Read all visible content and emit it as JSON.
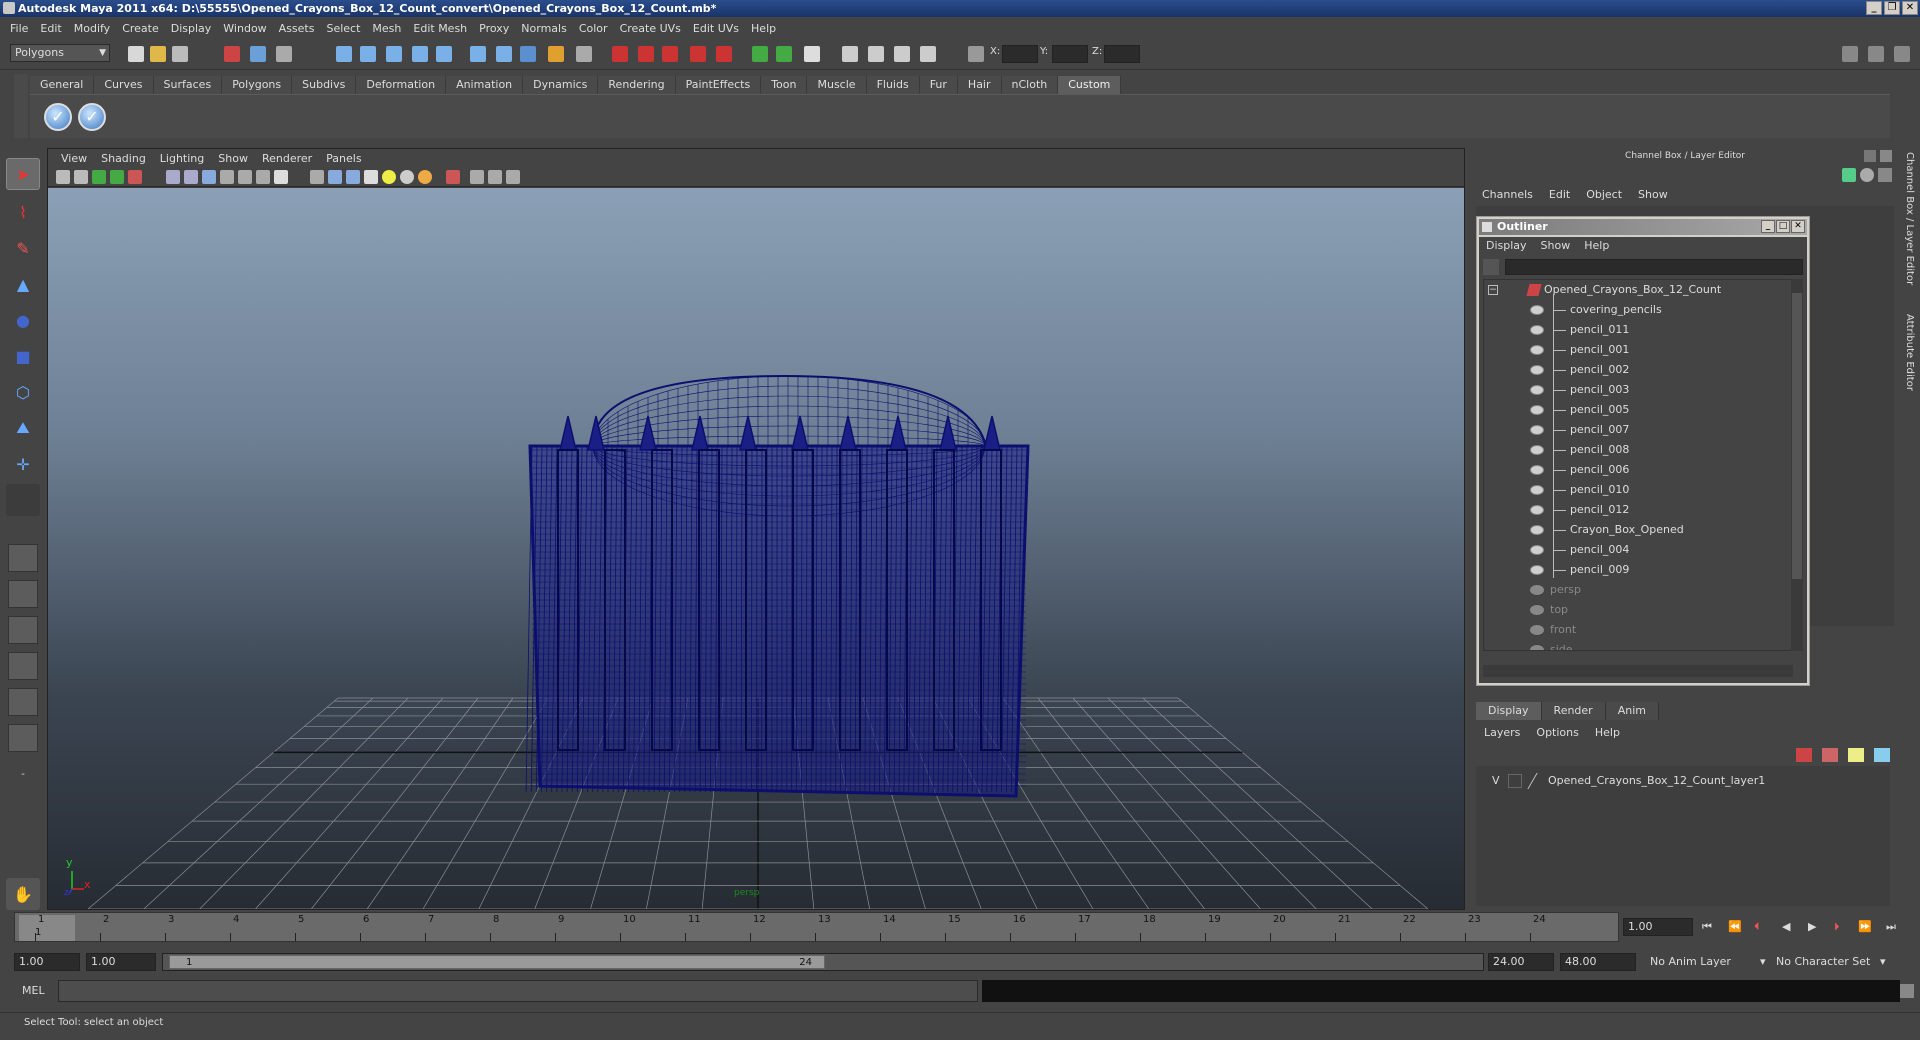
{
  "window": {
    "title": "Autodesk Maya 2011 x64: D:\\55555\\Opened_Crayons_Box_12_Count_convert\\Opened_Crayons_Box_12_Count.mb*"
  },
  "menus": [
    "File",
    "Edit",
    "Modify",
    "Create",
    "Display",
    "Window",
    "Assets",
    "Select",
    "Mesh",
    "Edit Mesh",
    "Proxy",
    "Normals",
    "Color",
    "Create UVs",
    "Edit UVs",
    "Help"
  ],
  "toolbar": {
    "mode": "Polygons",
    "x_label": "X:",
    "y_label": "Y:",
    "z_label": "Z:"
  },
  "shelf": {
    "tabs": [
      "General",
      "Curves",
      "Surfaces",
      "Polygons",
      "Subdivs",
      "Deformation",
      "Animation",
      "Dynamics",
      "Rendering",
      "PaintEffects",
      "Toon",
      "Muscle",
      "Fluids",
      "Fur",
      "Hair",
      "nCloth",
      "Custom"
    ],
    "active_tab": "Custom"
  },
  "viewport": {
    "menu": [
      "View",
      "Shading",
      "Lighting",
      "Show",
      "Renderer",
      "Panels"
    ],
    "camera_label": "persp",
    "axis_y": "y",
    "axis_x": "x",
    "axis_z": "z"
  },
  "right_panel": {
    "title": "Channel Box / Layer Editor",
    "menu": [
      "Channels",
      "Edit",
      "Object",
      "Show"
    ],
    "side_tab_1": "Channel Box / Layer Editor",
    "side_tab_2": "Attribute Editor"
  },
  "outliner": {
    "title": "Outliner",
    "menu": [
      "Display",
      "Show",
      "Help"
    ],
    "root": "Opened_Crayons_Box_12_Count",
    "children": [
      "covering_pencils",
      "pencil_011",
      "pencil_001",
      "pencil_002",
      "pencil_003",
      "pencil_005",
      "pencil_007",
      "pencil_008",
      "pencil_006",
      "pencil_010",
      "pencil_012",
      "Crayon_Box_Opened",
      "pencil_004",
      "pencil_009"
    ],
    "cameras": [
      "persp",
      "top",
      "front",
      "side"
    ]
  },
  "layer_editor": {
    "tabs": [
      "Display",
      "Render",
      "Anim"
    ],
    "active_tab": "Display",
    "menu": [
      "Layers",
      "Options",
      "Help"
    ],
    "layers": [
      {
        "visible": "V",
        "name": "Opened_Crayons_Box_12_Count_layer1"
      }
    ]
  },
  "timeline": {
    "ticks": [
      "1",
      "2",
      "3",
      "4",
      "5",
      "6",
      "7",
      "8",
      "9",
      "10",
      "11",
      "12",
      "13",
      "14",
      "15",
      "16",
      "17",
      "18",
      "19",
      "20",
      "21",
      "22",
      "23",
      "24"
    ],
    "current_marker": "1",
    "current_frame": "1.00"
  },
  "range": {
    "start": "1.00",
    "playback_start": "1.00",
    "handle_start": "1",
    "handle_end": "24",
    "playback_end": "24.00",
    "end": "48.00",
    "anim_layer": "No Anim Layer",
    "character_set": "No Character Set"
  },
  "command_line": {
    "label": "MEL"
  },
  "status_line": "Select Tool: select an object"
}
